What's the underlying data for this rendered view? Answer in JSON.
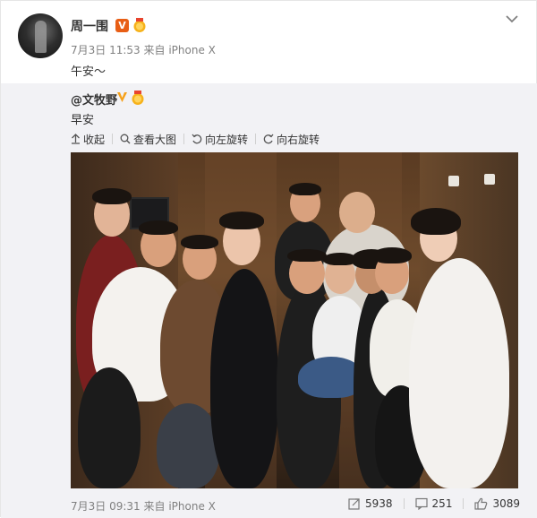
{
  "post": {
    "author": "周一围",
    "verified_label": "V",
    "time": "7月3日 11:53",
    "source_prefix": "来自",
    "source": "iPhone X",
    "text": "午安～"
  },
  "repost": {
    "author": "@文牧野",
    "text": "早安",
    "tools": {
      "collapse": "收起",
      "view_large": "查看大图",
      "rotate_left": "向左旋转",
      "rotate_right": "向右旋转"
    },
    "time": "7月3日 09:31",
    "source_prefix": "来自",
    "source": "iPhone X",
    "stats": {
      "reposts": "5938",
      "comments": "251",
      "likes": "3089"
    }
  },
  "icons": {
    "medal": "medal-icon",
    "chevron": "chevron-down-icon",
    "collapse": "arrow-up-icon",
    "zoom": "magnifier-icon",
    "rotate_left": "rotate-left-icon",
    "rotate_right": "rotate-right-icon",
    "repost": "repost-icon",
    "comment": "comment-icon",
    "like": "thumbs-up-icon"
  },
  "colors": {
    "verified": "#e85e15",
    "repost_bg": "#f2f2f5",
    "muted_text": "#808080",
    "link": "#eb7350"
  }
}
